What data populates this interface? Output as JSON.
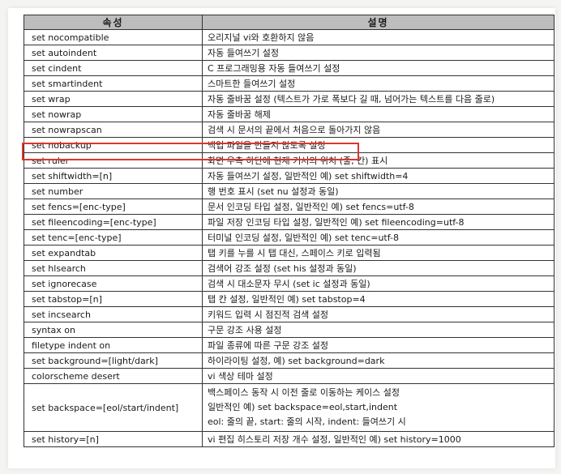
{
  "table": {
    "headers": [
      "속성",
      "설명"
    ],
    "rows": [
      {
        "attr": "set nocompatible",
        "desc": [
          "오리지널 vi와 호환하지 않음"
        ]
      },
      {
        "attr": "set autoindent",
        "desc": [
          "자동 들여쓰기 설정"
        ]
      },
      {
        "attr": "set cindent",
        "desc": [
          "C 프로그래밍용 자동 들여쓰기 설정"
        ]
      },
      {
        "attr": "set smartindent",
        "desc": [
          "스마트한 들여쓰기 설정"
        ]
      },
      {
        "attr": "set wrap",
        "desc": [
          "자동 줄바꿈 설정 (텍스트가 가로 폭보다 길 때, 넘어가는 텍스트를 다음 줄로)"
        ]
      },
      {
        "attr": "set nowrap",
        "desc": [
          "자동 줄바꿈 해제"
        ]
      },
      {
        "attr": "set nowrapscan",
        "desc": [
          "검색 시 문서의 끝에서 처음으로 돌아가지 않음"
        ]
      },
      {
        "attr": "set nobackup",
        "desc": [
          "백업 파일을 만들지 않도록 설정"
        ]
      },
      {
        "attr": "set ruler",
        "desc": [
          "화면 우측 하단에 현재 커서의 위치 (줄, 칸) 표시"
        ]
      },
      {
        "attr": "set shiftwidth=[n]",
        "desc": [
          "자동 들여쓰기 설정, 일반적인 예) set shiftwidth=4"
        ]
      },
      {
        "attr": "set number",
        "desc": [
          "행 번호 표시 (set nu 설정과 동일)"
        ]
      },
      {
        "attr": "set fencs=[enc-type]",
        "desc": [
          "문서 인코딩 타입 설정, 일반적인 예) set fencs=utf-8"
        ]
      },
      {
        "attr": "set fileencoding=[enc-type]",
        "desc": [
          "파일 저장 인코딩 타입 설정, 일반적인 예) set fileencoding=utf-8"
        ]
      },
      {
        "attr": "set tenc=[enc-type]",
        "desc": [
          "터미널 인코딩 설정, 일반적인 예) set tenc=utf-8"
        ]
      },
      {
        "attr": "set expandtab",
        "desc": [
          "탭 키를 누를 시 탭 대신, 스페이스 키로 입력됨"
        ]
      },
      {
        "attr": "set hlsearch",
        "desc": [
          "검색어 강조 설정 (set his 설정과 동일)"
        ]
      },
      {
        "attr": "set ignorecase",
        "desc": [
          "검색 시 대소문자 무시 (set ic 설정과 동일)"
        ]
      },
      {
        "attr": "set tabstop=[n]",
        "desc": [
          "탭 칸 설정, 일반적인 예) set tabstop=4"
        ]
      },
      {
        "attr": "set incsearch",
        "desc": [
          "키워드 입력 시 점진적 검색 설정"
        ]
      },
      {
        "attr": "syntax on",
        "desc": [
          "구문 강조 사용 설정"
        ]
      },
      {
        "attr": "filetype indent on",
        "desc": [
          "파일 종류에 따른 구문 강조 설정"
        ]
      },
      {
        "attr": "set background=[light/dark]",
        "desc": [
          "하이라이팅 설정, 예) set background=dark"
        ]
      },
      {
        "attr": "colorscheme desert",
        "desc": [
          "vi 색상 테마 설정"
        ]
      },
      {
        "attr": "set backspace=[eol/start/indent]",
        "desc": [
          "백스페이스 동작 시 이전 줄로 이동하는 케이스 설정",
          "일반적인 예) set backspace=eol,start,indent",
          "eol: 줄의 끝, start: 줄의 시작, indent: 들여쓰기 시"
        ]
      },
      {
        "attr": "set history=[n]",
        "desc": [
          "vi 편집 히스토리 저장 개수 설정, 일반적인 예) set history=1000"
        ]
      }
    ]
  },
  "colors": {
    "header_bg": "#bdbdbd",
    "highlight": "#e0352b",
    "border": "#333333"
  }
}
